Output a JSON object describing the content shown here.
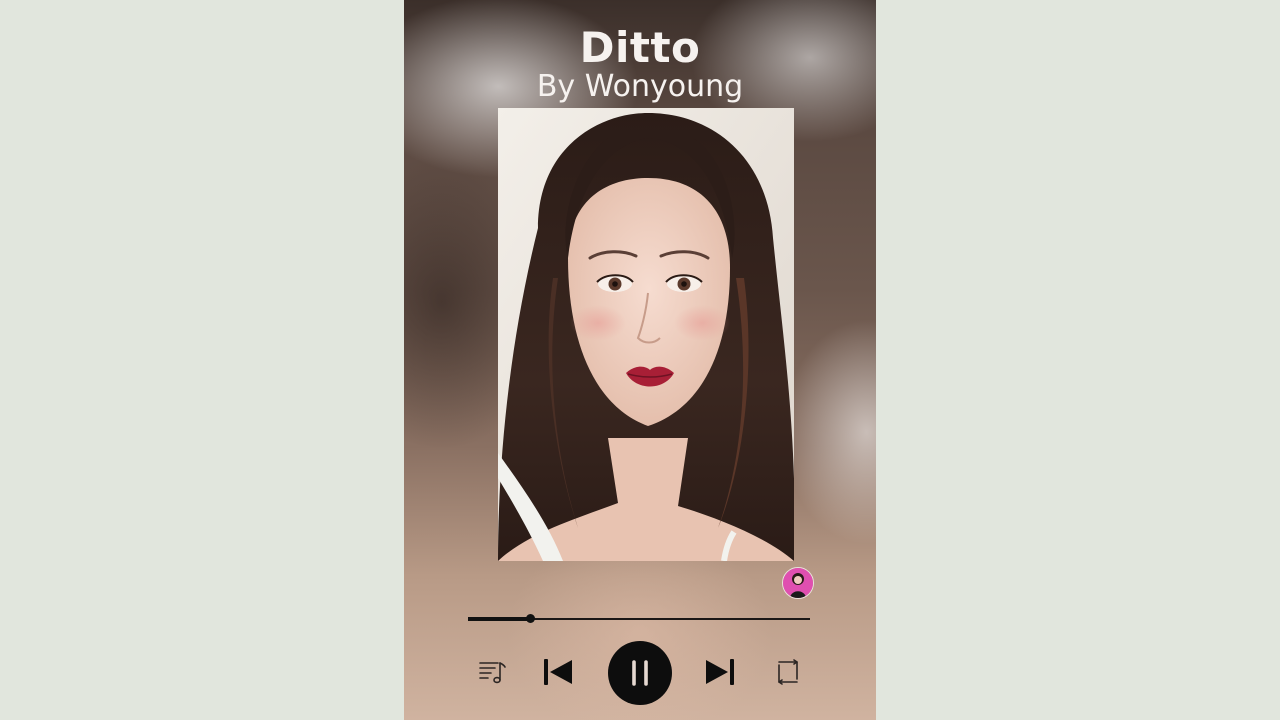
{
  "track": {
    "title": "Ditto",
    "artist_line": "By Wonyoung"
  },
  "player": {
    "progress": 0.18,
    "state": "playing"
  },
  "icons": {
    "playlist": "playlist-icon",
    "previous": "skip-previous-icon",
    "pause": "pause-icon",
    "next": "skip-next-icon",
    "repeat": "repeat-icon"
  },
  "colors": {
    "page_background": "#e1e6dd",
    "text": "#f6f2ef",
    "control": "#0d0d0d",
    "avatar_ring": "#e04fb0"
  }
}
